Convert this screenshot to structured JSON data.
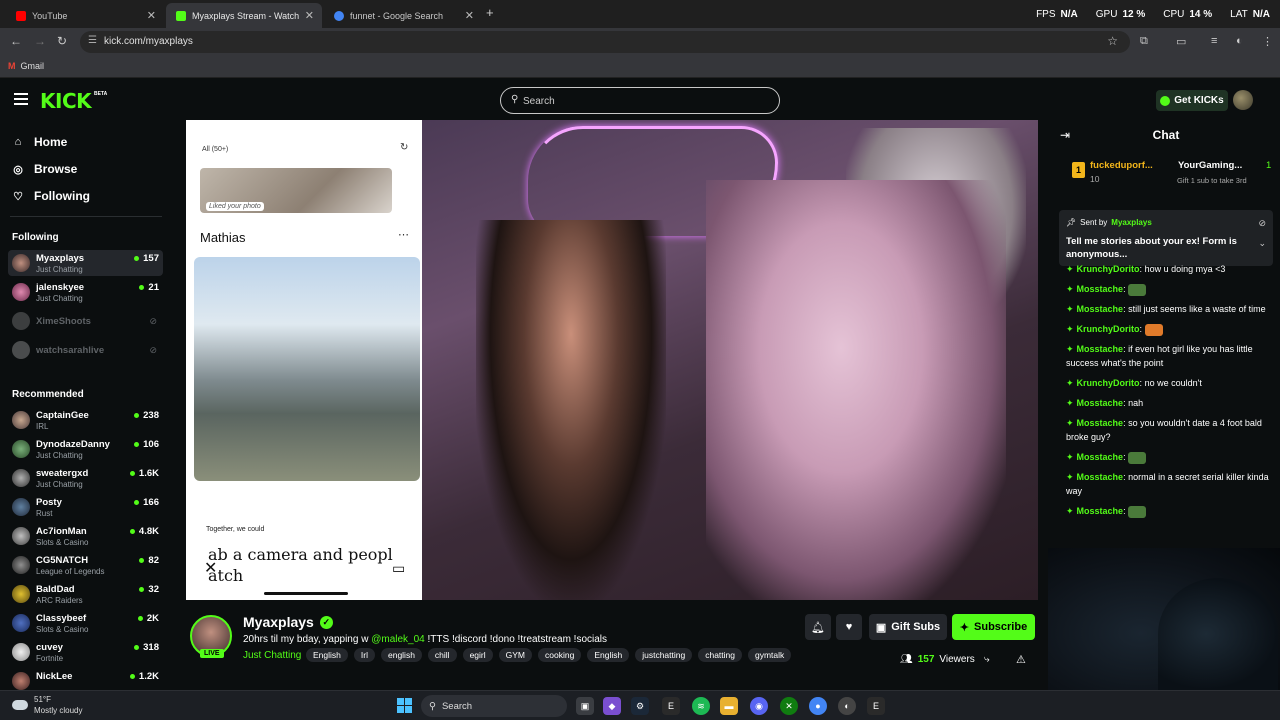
{
  "browser": {
    "tabs": [
      {
        "label": "YouTube",
        "color": "#ff0000"
      },
      {
        "label": "Myaxplays Stream - Watch",
        "color": "#53fc18"
      },
      {
        "label": "funnet - Google Search",
        "color": "#4285f4"
      }
    ],
    "url": "kick.com/myaxplays",
    "bookmark": "Gmail",
    "perf": {
      "fps_label": "FPS",
      "fps": "N/A",
      "gpu_label": "GPU",
      "gpu": "12 %",
      "cpu_label": "CPU",
      "cpu": "14 %",
      "lat_label": "LAT",
      "lat": "N/A"
    }
  },
  "header": {
    "logo": "KICK",
    "beta": "BETA",
    "search_placeholder": "Search",
    "get_kicks": "Get KICKs"
  },
  "sidebar": {
    "nav": [
      {
        "label": "Home",
        "icon": "home-icon"
      },
      {
        "label": "Browse",
        "icon": "compass-icon"
      },
      {
        "label": "Following",
        "icon": "heart-icon"
      }
    ],
    "following_heading": "Following",
    "following": [
      {
        "name": "Myaxplays",
        "category": "Just Chatting",
        "viewers": "157",
        "online": true
      },
      {
        "name": "jalenskyee",
        "category": "Just Chatting",
        "viewers": "21",
        "online": true
      },
      {
        "name": "XimeShoots",
        "online": false
      },
      {
        "name": "watchsarahlive",
        "online": false
      }
    ],
    "recommended_heading": "Recommended",
    "recommended": [
      {
        "name": "CaptainGee",
        "category": "IRL",
        "viewers": "238"
      },
      {
        "name": "DynodazeDanny",
        "category": "Just Chatting",
        "viewers": "106"
      },
      {
        "name": "sweatergxd",
        "category": "Just Chatting",
        "viewers": "1.6K"
      },
      {
        "name": "Posty",
        "category": "Rust",
        "viewers": "166"
      },
      {
        "name": "Ac7ionMan",
        "category": "Slots & Casino",
        "viewers": "4.8K"
      },
      {
        "name": "CG5NATCH",
        "category": "League of Legends",
        "viewers": "82"
      },
      {
        "name": "BaldDad",
        "category": "ARC Raiders",
        "viewers": "32"
      },
      {
        "name": "Classybeef",
        "category": "Slots & Casino",
        "viewers": "2K"
      },
      {
        "name": "cuvey",
        "category": "Fortnite",
        "viewers": "318"
      },
      {
        "name": "NickLee",
        "category": "",
        "viewers": "1.2K"
      }
    ]
  },
  "video": {
    "phone": {
      "filter": "All (50+)",
      "liked": "Liked your photo",
      "name": "Mathias",
      "together": "Together, we could",
      "big_text": "ab a camera and peopl\natch"
    }
  },
  "stream": {
    "streamer": "Myaxplays",
    "live": "LIVE",
    "title_pre": "20hrs til my bday, yapping w ",
    "title_mention": "@malek_04",
    "title_post": " !TTS !discord !dono !treatstream !socials",
    "category": "Just Chatting",
    "tags": [
      "English",
      "Irl",
      "english",
      "chill",
      "egirl",
      "GYM",
      "cooking",
      "English",
      "justchatting",
      "chatting",
      "gymtalk"
    ],
    "gift_subs": "Gift Subs",
    "subscribe": "Subscribe",
    "viewers": "157",
    "viewers_label": "Viewers"
  },
  "chat": {
    "title": "Chat",
    "gifts": [
      {
        "name": "fuckeduporf...",
        "rank": "1",
        "count": "10"
      },
      {
        "name": "YourGaming...",
        "count": "1",
        "sub": "Gift 1 sub to take 3rd"
      }
    ],
    "pinned": {
      "sent_by": "Sent by",
      "user": "Myaxplays",
      "message": "Tell me stories about your ex! Form is anonymous..."
    },
    "messages": [
      {
        "user": "KrunchyDorito",
        "color": "#53fc18",
        "text": "how u doing mya <3"
      },
      {
        "user": "Mosstache",
        "color": "#53fc18",
        "text": "",
        "emote": "#4a7a3a"
      },
      {
        "user": "Mosstache",
        "color": "#53fc18",
        "text": "still just seems like a waste of time"
      },
      {
        "user": "KrunchyDorito",
        "color": "#53fc18",
        "text": "",
        "emote": "#e07a2a"
      },
      {
        "user": "Mosstache",
        "color": "#53fc18",
        "text": "if even hot girl like you has little success what's the point"
      },
      {
        "user": "KrunchyDorito",
        "color": "#53fc18",
        "text": "no we couldn't"
      },
      {
        "user": "Mosstache",
        "color": "#53fc18",
        "text": "nah"
      },
      {
        "user": "Mosstache",
        "color": "#53fc18",
        "text": "so you wouldn't date a 4 foot bald broke guy?"
      },
      {
        "user": "Mosstache",
        "color": "#53fc18",
        "text": "",
        "emote": "#4a7a3a"
      },
      {
        "user": "Mosstache",
        "color": "#53fc18",
        "text": "normal in a secret serial killer kinda way"
      },
      {
        "user": "Mosstache",
        "color": "#53fc18",
        "text": "",
        "emote": "#4a7a3a"
      }
    ]
  },
  "taskbar": {
    "temp": "51°F",
    "weather": "Mostly cloudy",
    "search": "Search"
  }
}
